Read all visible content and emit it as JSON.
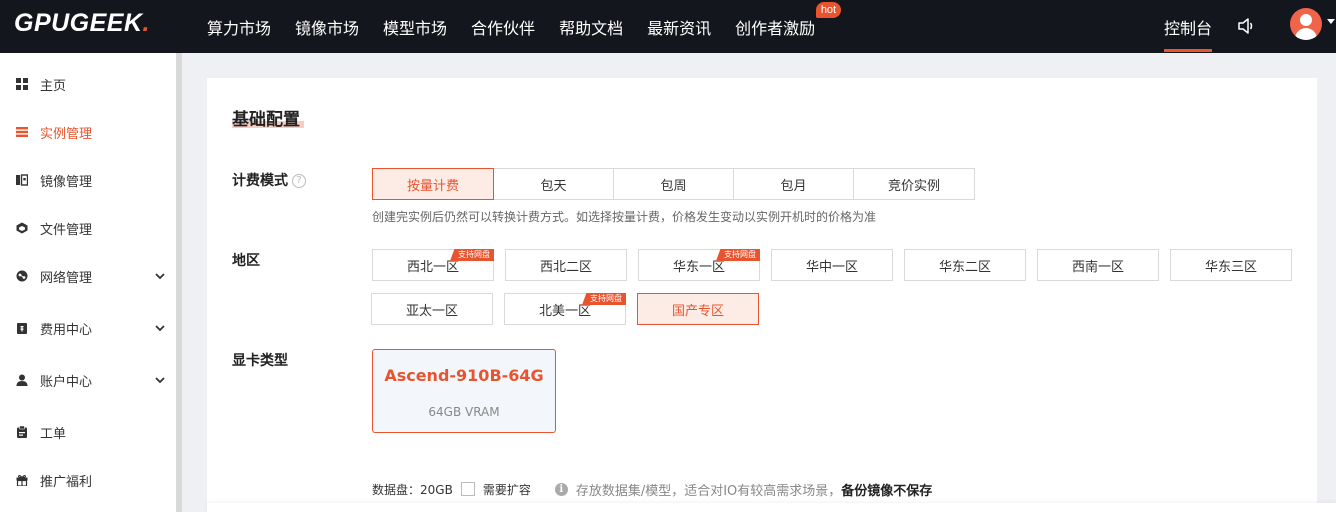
{
  "brand": {
    "logo_main": "GPUGEEK",
    "logo_dot": "."
  },
  "nav": {
    "items": [
      "算力市场",
      "镜像市场",
      "模型市场",
      "合作伙伴",
      "帮助文档",
      "最新资讯",
      "创作者激励"
    ],
    "hot_badge": "hot",
    "console": "控制台"
  },
  "sidebar": {
    "items": [
      {
        "label": "主页",
        "icon": "grid-icon"
      },
      {
        "label": "实例管理",
        "icon": "list-icon",
        "active": true
      },
      {
        "label": "镜像管理",
        "icon": "image-icon"
      },
      {
        "label": "文件管理",
        "icon": "box-icon"
      },
      {
        "label": "网络管理",
        "icon": "network-icon",
        "expandable": true
      },
      {
        "label": "费用中心",
        "icon": "wallet-icon",
        "expandable": true
      },
      {
        "label": "账户中心",
        "icon": "user-icon",
        "expandable": true
      },
      {
        "label": "工单",
        "icon": "clipboard-icon"
      },
      {
        "label": "推广福利",
        "icon": "gift-icon"
      }
    ]
  },
  "config": {
    "title": "基础配置",
    "billing": {
      "label": "计费模式",
      "help": "?",
      "options": [
        "按量计费",
        "包天",
        "包周",
        "包月",
        "竞价实例"
      ],
      "selected": "按量计费",
      "hint": "创建完实例后仍然可以转换计费方式。如选择按量计费，价格发生变动以实例开机时的价格为准"
    },
    "region": {
      "label": "地区",
      "tag_text": "支持网盘",
      "options": [
        "西北一区",
        "西北二区",
        "华东一区",
        "华中一区",
        "华东二区",
        "西南一区",
        "华东三区",
        "亚太一区",
        "北美一区",
        "国产专区"
      ],
      "selected": "国产专区"
    },
    "gpu": {
      "label": "显卡类型",
      "name": "Ascend-910B-64G",
      "vram": "64GB VRAM"
    },
    "disk": {
      "label": "数据盘：20GB",
      "expand_label": "需要扩容",
      "info_icon": "i",
      "info_text": "存放数据集/模型，适合对IO有较高需求场景，",
      "info_bold": "备份镜像不保存"
    }
  },
  "colors": {
    "accent": "#e8542d",
    "topbar": "#14161d"
  }
}
